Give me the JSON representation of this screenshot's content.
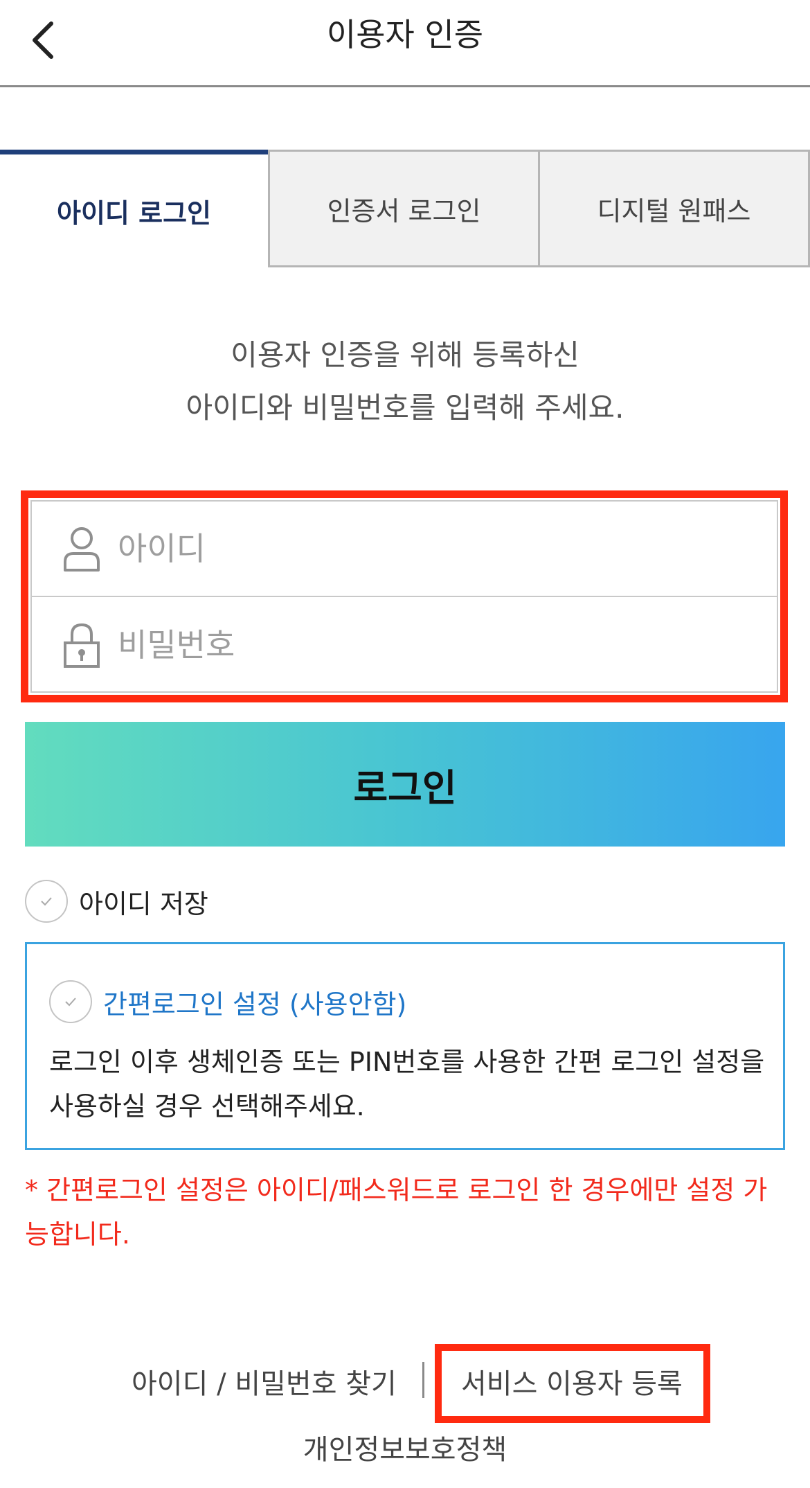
{
  "header": {
    "title": "이용자 인증",
    "back_icon": "chevron-left-icon"
  },
  "tabs": [
    {
      "label": "아이디 로그인",
      "active": true
    },
    {
      "label": "인증서 로그인",
      "active": false
    },
    {
      "label": "디지털 원패스",
      "active": false
    }
  ],
  "description": {
    "line1": "이용자 인증을 위해 등록하신",
    "line2": "아이디와 비밀번호를 입력해 주세요."
  },
  "form": {
    "id_placeholder": "아이디",
    "id_value": "",
    "password_placeholder": "비밀번호",
    "password_value": "",
    "login_label": "로그인",
    "save_id_label": "아이디 저장"
  },
  "simple_login": {
    "label": "간편로그인 설정 (사용안함)",
    "description": "로그인 이후 생체인증 또는 PIN번호를 사용한 간편 로그인 설정을 사용하실 경우 선택해주세요.",
    "notice": "* 간편로그인 설정은 아이디/패스워드로 로그인 한 경우에만 설정 가능합니다."
  },
  "footer": {
    "find_label": "아이디 / 비밀번호 찾기",
    "register_label": "서비스 이용자 등록",
    "privacy_label": "개인정보보호정책"
  },
  "colors": {
    "highlight": "#ff2a10",
    "active_tab": "#1f3f7a",
    "simple_login_text": "#1f76c8",
    "notice_text": "#f22a1c",
    "gradient_start": "#62dcbe",
    "gradient_end": "#38a5ee"
  }
}
